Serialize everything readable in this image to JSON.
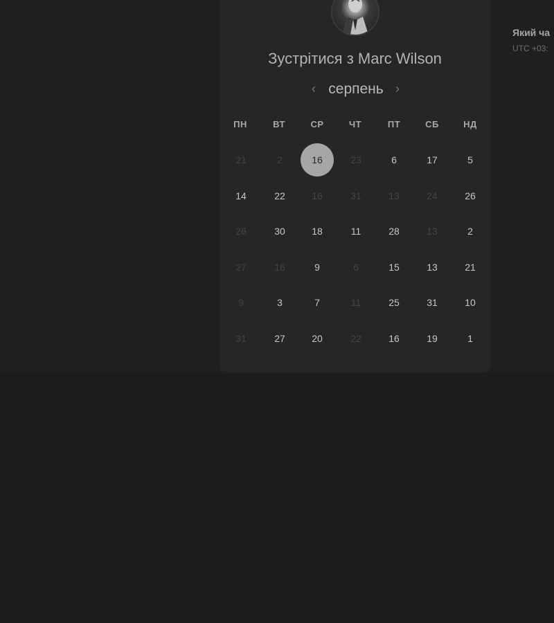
{
  "title": "Зустрітися з Marc Wilson",
  "month": {
    "label": "серпень",
    "prev_icon": "‹",
    "next_icon": "›"
  },
  "weekdays": [
    "ПН",
    "ВТ",
    "СР",
    "ЧТ",
    "ПТ",
    "СБ",
    "НД"
  ],
  "weeks": [
    [
      {
        "d": "21",
        "a": false
      },
      {
        "d": "2",
        "a": false
      },
      {
        "d": "16",
        "a": true,
        "sel": true
      },
      {
        "d": "23",
        "a": false
      },
      {
        "d": "6",
        "a": true
      },
      {
        "d": "17",
        "a": true
      },
      {
        "d": "5",
        "a": true
      }
    ],
    [
      {
        "d": "14",
        "a": true
      },
      {
        "d": "22",
        "a": true
      },
      {
        "d": "16",
        "a": false
      },
      {
        "d": "31",
        "a": false
      },
      {
        "d": "13",
        "a": false
      },
      {
        "d": "24",
        "a": false
      },
      {
        "d": "26",
        "a": true
      }
    ],
    [
      {
        "d": "26",
        "a": false
      },
      {
        "d": "30",
        "a": true
      },
      {
        "d": "18",
        "a": true
      },
      {
        "d": "11",
        "a": true
      },
      {
        "d": "28",
        "a": true
      },
      {
        "d": "13",
        "a": false
      },
      {
        "d": "2",
        "a": true
      }
    ],
    [
      {
        "d": "27",
        "a": false
      },
      {
        "d": "16",
        "a": false
      },
      {
        "d": "9",
        "a": true
      },
      {
        "d": "6",
        "a": false
      },
      {
        "d": "15",
        "a": true
      },
      {
        "d": "13",
        "a": true
      },
      {
        "d": "21",
        "a": true
      }
    ],
    [
      {
        "d": "9",
        "a": false
      },
      {
        "d": "3",
        "a": true
      },
      {
        "d": "7",
        "a": true
      },
      {
        "d": "11",
        "a": false
      },
      {
        "d": "25",
        "a": true
      },
      {
        "d": "31",
        "a": true
      },
      {
        "d": "10",
        "a": true
      }
    ],
    [
      {
        "d": "31",
        "a": false
      },
      {
        "d": "27",
        "a": true
      },
      {
        "d": "20",
        "a": true
      },
      {
        "d": "22",
        "a": false
      },
      {
        "d": "16",
        "a": true
      },
      {
        "d": "19",
        "a": true
      },
      {
        "d": "1",
        "a": true
      }
    ]
  ],
  "side": {
    "title": "Який ча",
    "timezone": "UTC +03:"
  },
  "colors": {
    "background": "#1c1c1d",
    "card": "#262627",
    "selected": "#a6a6a6",
    "text": "#c8c8c8",
    "muted": "#444445"
  },
  "icons": {
    "avatar": "person-photo",
    "prev": "chevron-left-icon",
    "next": "chevron-right-icon"
  }
}
